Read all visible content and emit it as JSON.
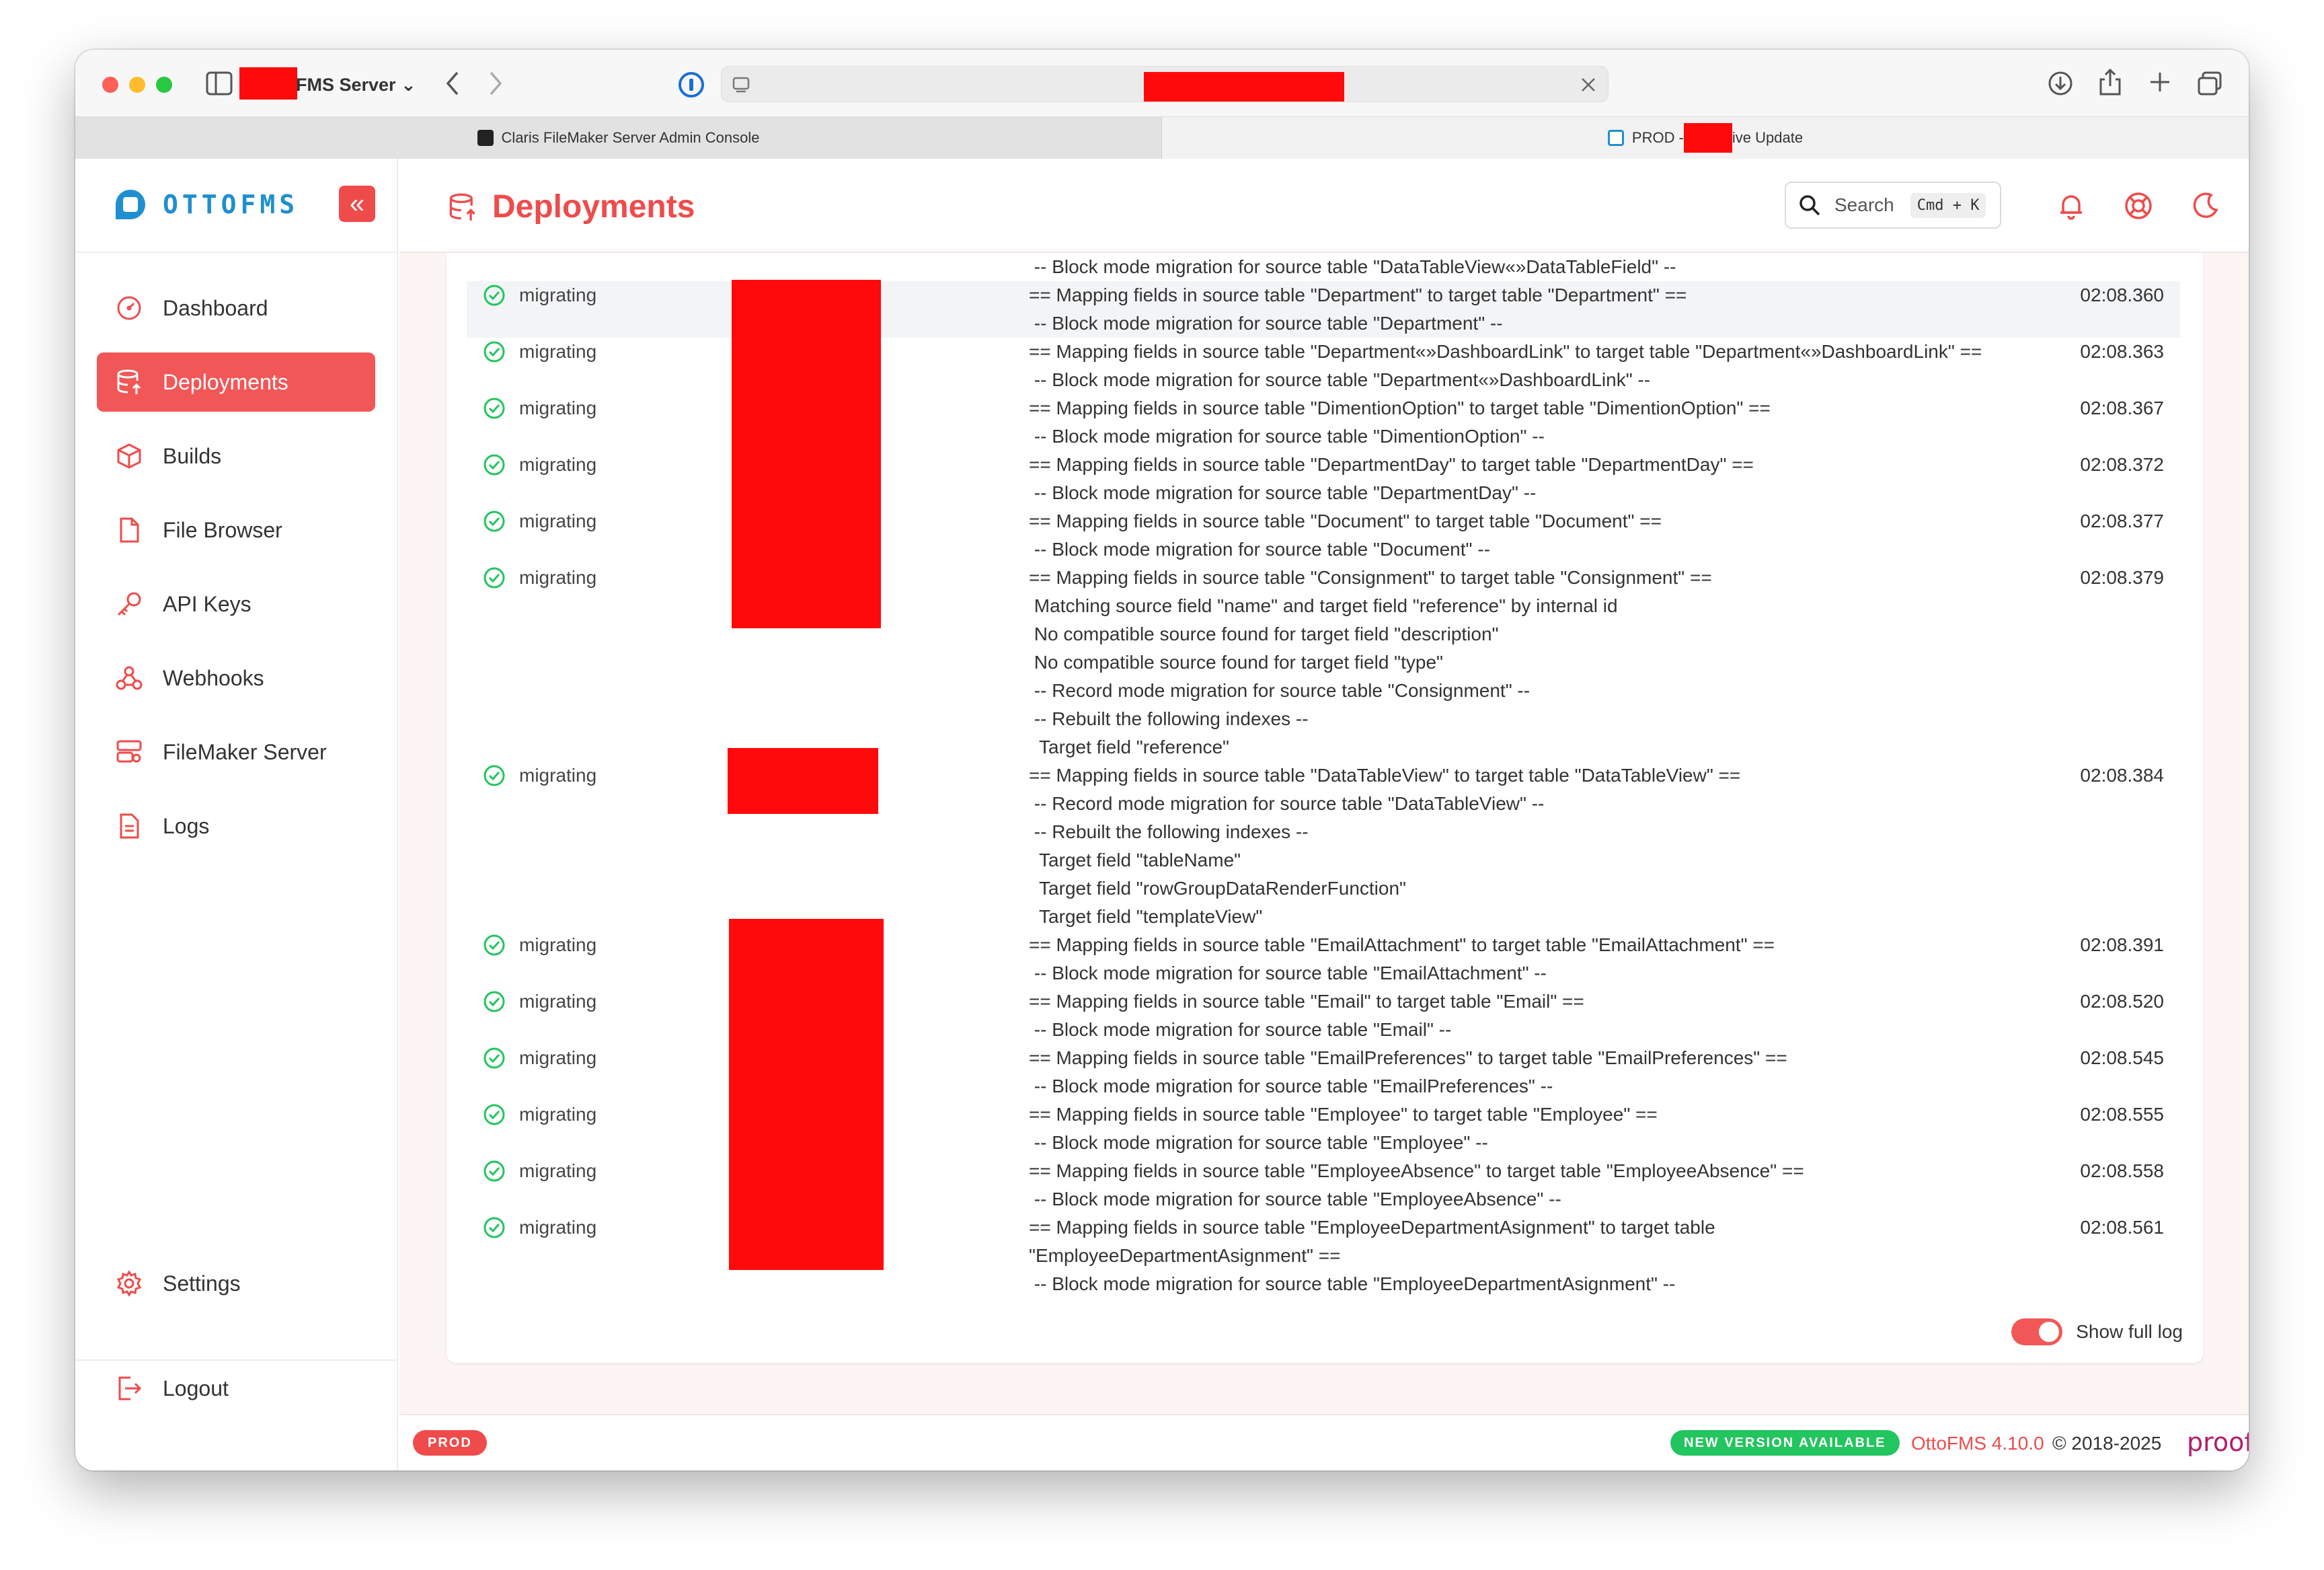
{
  "browser": {
    "profile_name": "FMS Server",
    "tabs": [
      {
        "label": "Claris FileMaker Server Admin Console"
      },
      {
        "label_prefix": "PROD - ",
        "label_suffix": "ive Update"
      }
    ]
  },
  "sidebar": {
    "logo_text": "OTTOFMS",
    "collapse_glyph": "«",
    "items": [
      {
        "label": "Dashboard",
        "icon": "gauge-icon"
      },
      {
        "label": "Deployments",
        "icon": "database-upload-icon",
        "active": true
      },
      {
        "label": "Builds",
        "icon": "cube-icon"
      },
      {
        "label": "File Browser",
        "icon": "file-icon"
      },
      {
        "label": "API Keys",
        "icon": "key-icon"
      },
      {
        "label": "Webhooks",
        "icon": "webhook-icon"
      },
      {
        "label": "FileMaker Server",
        "icon": "server-icon"
      },
      {
        "label": "Logs",
        "icon": "document-icon"
      }
    ],
    "settings_label": "Settings",
    "logout_label": "Logout"
  },
  "header": {
    "title": "Deployments",
    "search_label": "Search",
    "search_shortcut": "Cmd + K"
  },
  "log": {
    "top_partial_line": " -- Block mode migration for source table \"DataTableView«»DataTableField\" --",
    "rows": [
      {
        "status": "migrating",
        "time": "02:08.360",
        "lines": [
          "== Mapping fields in source table \"Department\" to target table \"Department\" ==",
          " -- Block mode migration for source table \"Department\" --"
        ]
      },
      {
        "status": "migrating",
        "time": "02:08.363",
        "lines": [
          "== Mapping fields in source table \"Department«»DashboardLink\" to target table \"Department«»DashboardLink\" ==",
          " -- Block mode migration for source table \"Department«»DashboardLink\" --"
        ]
      },
      {
        "status": "migrating",
        "time": "02:08.367",
        "lines": [
          "== Mapping fields in source table \"DimentionOption\" to target table \"DimentionOption\" ==",
          " -- Block mode migration for source table \"DimentionOption\" --"
        ]
      },
      {
        "status": "migrating",
        "time": "02:08.372",
        "lines": [
          "== Mapping fields in source table \"DepartmentDay\" to target table \"DepartmentDay\" ==",
          " -- Block mode migration for source table \"DepartmentDay\" --"
        ]
      },
      {
        "status": "migrating",
        "time": "02:08.377",
        "lines": [
          "== Mapping fields in source table \"Document\" to target table \"Document\" ==",
          " -- Block mode migration for source table \"Document\" --"
        ]
      },
      {
        "status": "migrating",
        "time": "02:08.379",
        "lines": [
          "== Mapping fields in source table \"Consignment\" to target table \"Consignment\" ==",
          " Matching source field \"name\" and target field \"reference\" by internal id",
          " No compatible source found for target field \"description\"",
          " No compatible source found for target field \"type\"",
          " -- Record mode migration for source table \"Consignment\" --",
          " -- Rebuilt the following indexes --",
          "  Target field \"reference\""
        ]
      },
      {
        "status": "migrating",
        "time": "02:08.384",
        "lines": [
          "== Mapping fields in source table \"DataTableView\" to target table \"DataTableView\" ==",
          " -- Record mode migration for source table \"DataTableView\" --",
          " -- Rebuilt the following indexes --",
          "  Target field \"tableName\"",
          "  Target field \"rowGroupDataRenderFunction\"",
          "  Target field \"templateView\""
        ]
      },
      {
        "status": "migrating",
        "time": "02:08.391",
        "lines": [
          "== Mapping fields in source table \"EmailAttachment\" to target table \"EmailAttachment\" ==",
          " -- Block mode migration for source table \"EmailAttachment\" --"
        ]
      },
      {
        "status": "migrating",
        "time": "02:08.520",
        "lines": [
          "== Mapping fields in source table \"Email\" to target table \"Email\" ==",
          " -- Block mode migration for source table \"Email\" --"
        ]
      },
      {
        "status": "migrating",
        "time": "02:08.545",
        "lines": [
          "== Mapping fields in source table \"EmailPreferences\" to target table \"EmailPreferences\" ==",
          " -- Block mode migration for source table \"EmailPreferences\" --"
        ]
      },
      {
        "status": "migrating",
        "time": "02:08.555",
        "lines": [
          "== Mapping fields in source table \"Employee\" to target table \"Employee\" ==",
          " -- Block mode migration for source table \"Employee\" --"
        ]
      },
      {
        "status": "migrating",
        "time": "02:08.558",
        "lines": [
          "== Mapping fields in source table \"EmployeeAbsence\" to target table \"EmployeeAbsence\" ==",
          " -- Block mode migration for source table \"EmployeeAbsence\" --"
        ]
      },
      {
        "status": "migrating",
        "time": "02:08.561",
        "lines": [
          "== Mapping fields in source table \"EmployeeDepartmentAsignment\" to target table",
          "\"EmployeeDepartmentAsignment\" ==",
          " -- Block mode migration for source table \"EmployeeDepartmentAsignment\" --"
        ]
      }
    ],
    "show_full_log_label": "Show full log",
    "show_full_log": true
  },
  "footer": {
    "env_badge": "PROD",
    "new_version_badge": "NEW VERSION AVAILABLE",
    "version": "OttoFMS 4.10.0",
    "copyright": "© 2018-2025",
    "brand": "proof+geist"
  },
  "colors": {
    "accent": "#ef4b4b",
    "success": "#22c55e",
    "logo": "#1f8fcf",
    "redaction": "#ff0a0a"
  }
}
